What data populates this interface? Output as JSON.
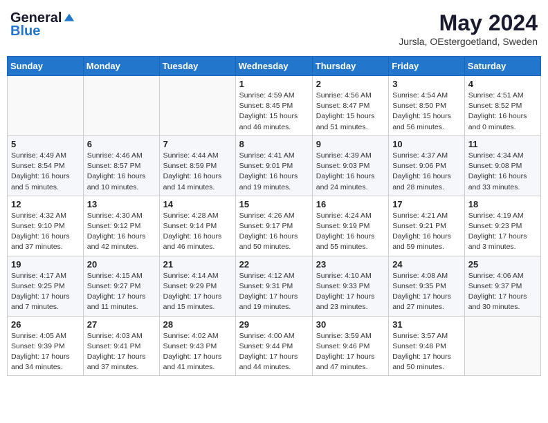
{
  "header": {
    "logo_general": "General",
    "logo_blue": "Blue",
    "month_title": "May 2024",
    "location": "Jursla, OEstergoetland, Sweden"
  },
  "days_of_week": [
    "Sunday",
    "Monday",
    "Tuesday",
    "Wednesday",
    "Thursday",
    "Friday",
    "Saturday"
  ],
  "weeks": [
    [
      {
        "day": "",
        "info": ""
      },
      {
        "day": "",
        "info": ""
      },
      {
        "day": "",
        "info": ""
      },
      {
        "day": "1",
        "info": "Sunrise: 4:59 AM\nSunset: 8:45 PM\nDaylight: 15 hours and 46 minutes."
      },
      {
        "day": "2",
        "info": "Sunrise: 4:56 AM\nSunset: 8:47 PM\nDaylight: 15 hours and 51 minutes."
      },
      {
        "day": "3",
        "info": "Sunrise: 4:54 AM\nSunset: 8:50 PM\nDaylight: 15 hours and 56 minutes."
      },
      {
        "day": "4",
        "info": "Sunrise: 4:51 AM\nSunset: 8:52 PM\nDaylight: 16 hours and 0 minutes."
      }
    ],
    [
      {
        "day": "5",
        "info": "Sunrise: 4:49 AM\nSunset: 8:54 PM\nDaylight: 16 hours and 5 minutes."
      },
      {
        "day": "6",
        "info": "Sunrise: 4:46 AM\nSunset: 8:57 PM\nDaylight: 16 hours and 10 minutes."
      },
      {
        "day": "7",
        "info": "Sunrise: 4:44 AM\nSunset: 8:59 PM\nDaylight: 16 hours and 14 minutes."
      },
      {
        "day": "8",
        "info": "Sunrise: 4:41 AM\nSunset: 9:01 PM\nDaylight: 16 hours and 19 minutes."
      },
      {
        "day": "9",
        "info": "Sunrise: 4:39 AM\nSunset: 9:03 PM\nDaylight: 16 hours and 24 minutes."
      },
      {
        "day": "10",
        "info": "Sunrise: 4:37 AM\nSunset: 9:06 PM\nDaylight: 16 hours and 28 minutes."
      },
      {
        "day": "11",
        "info": "Sunrise: 4:34 AM\nSunset: 9:08 PM\nDaylight: 16 hours and 33 minutes."
      }
    ],
    [
      {
        "day": "12",
        "info": "Sunrise: 4:32 AM\nSunset: 9:10 PM\nDaylight: 16 hours and 37 minutes."
      },
      {
        "day": "13",
        "info": "Sunrise: 4:30 AM\nSunset: 9:12 PM\nDaylight: 16 hours and 42 minutes."
      },
      {
        "day": "14",
        "info": "Sunrise: 4:28 AM\nSunset: 9:14 PM\nDaylight: 16 hours and 46 minutes."
      },
      {
        "day": "15",
        "info": "Sunrise: 4:26 AM\nSunset: 9:17 PM\nDaylight: 16 hours and 50 minutes."
      },
      {
        "day": "16",
        "info": "Sunrise: 4:24 AM\nSunset: 9:19 PM\nDaylight: 16 hours and 55 minutes."
      },
      {
        "day": "17",
        "info": "Sunrise: 4:21 AM\nSunset: 9:21 PM\nDaylight: 16 hours and 59 minutes."
      },
      {
        "day": "18",
        "info": "Sunrise: 4:19 AM\nSunset: 9:23 PM\nDaylight: 17 hours and 3 minutes."
      }
    ],
    [
      {
        "day": "19",
        "info": "Sunrise: 4:17 AM\nSunset: 9:25 PM\nDaylight: 17 hours and 7 minutes."
      },
      {
        "day": "20",
        "info": "Sunrise: 4:15 AM\nSunset: 9:27 PM\nDaylight: 17 hours and 11 minutes."
      },
      {
        "day": "21",
        "info": "Sunrise: 4:14 AM\nSunset: 9:29 PM\nDaylight: 17 hours and 15 minutes."
      },
      {
        "day": "22",
        "info": "Sunrise: 4:12 AM\nSunset: 9:31 PM\nDaylight: 17 hours and 19 minutes."
      },
      {
        "day": "23",
        "info": "Sunrise: 4:10 AM\nSunset: 9:33 PM\nDaylight: 17 hours and 23 minutes."
      },
      {
        "day": "24",
        "info": "Sunrise: 4:08 AM\nSunset: 9:35 PM\nDaylight: 17 hours and 27 minutes."
      },
      {
        "day": "25",
        "info": "Sunrise: 4:06 AM\nSunset: 9:37 PM\nDaylight: 17 hours and 30 minutes."
      }
    ],
    [
      {
        "day": "26",
        "info": "Sunrise: 4:05 AM\nSunset: 9:39 PM\nDaylight: 17 hours and 34 minutes."
      },
      {
        "day": "27",
        "info": "Sunrise: 4:03 AM\nSunset: 9:41 PM\nDaylight: 17 hours and 37 minutes."
      },
      {
        "day": "28",
        "info": "Sunrise: 4:02 AM\nSunset: 9:43 PM\nDaylight: 17 hours and 41 minutes."
      },
      {
        "day": "29",
        "info": "Sunrise: 4:00 AM\nSunset: 9:44 PM\nDaylight: 17 hours and 44 minutes."
      },
      {
        "day": "30",
        "info": "Sunrise: 3:59 AM\nSunset: 9:46 PM\nDaylight: 17 hours and 47 minutes."
      },
      {
        "day": "31",
        "info": "Sunrise: 3:57 AM\nSunset: 9:48 PM\nDaylight: 17 hours and 50 minutes."
      },
      {
        "day": "",
        "info": ""
      }
    ]
  ]
}
